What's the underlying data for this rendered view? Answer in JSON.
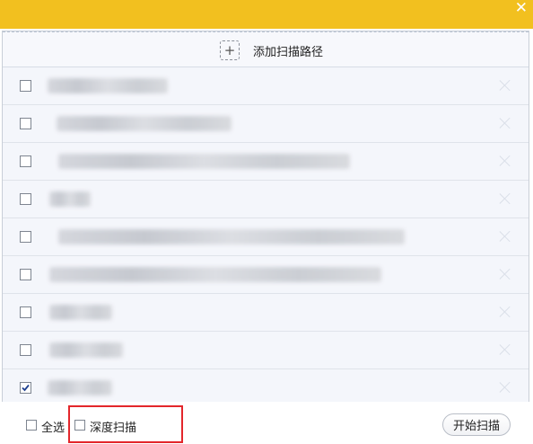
{
  "window": {
    "close_glyph": "✕",
    "accent_color": "#f2c01f"
  },
  "add_path": {
    "plus_glyph": "+",
    "label": "添加扫描路径"
  },
  "paths": [
    {
      "checked": false
    },
    {
      "checked": false
    },
    {
      "checked": false
    },
    {
      "checked": false
    },
    {
      "checked": false
    },
    {
      "checked": false
    },
    {
      "checked": false
    },
    {
      "checked": false
    },
    {
      "checked": true
    }
  ],
  "footer": {
    "select_all_label": "全选",
    "select_all_checked": false,
    "deep_scan_label": "深度扫描",
    "deep_scan_checked": false,
    "start_button_label": "开始扫描",
    "highlight_color": "#e3262b"
  }
}
